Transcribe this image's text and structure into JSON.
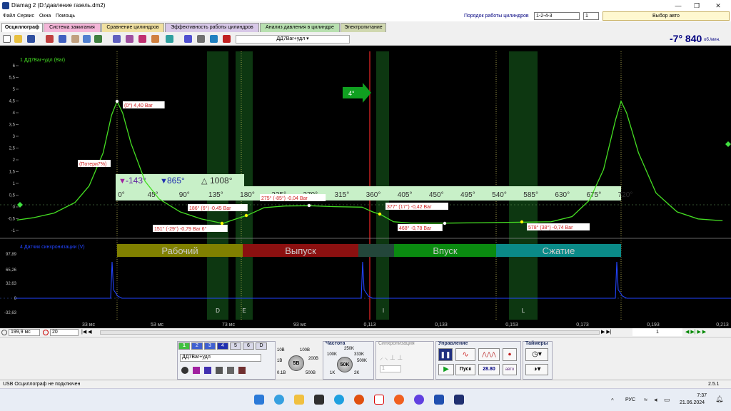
{
  "window": {
    "title": "Diamag 2 (D:\\давление газель.dm2)",
    "controls": [
      "—",
      "❐",
      "✕"
    ]
  },
  "menu": [
    "Файл",
    "Сервис",
    "Окна",
    "Помощь"
  ],
  "header": {
    "cyl_order_label": "Порядок работы цилиндров",
    "cyl_order_value": "1-2-4-3",
    "cyl_num_value": "1",
    "mode_value": "Выбор авто"
  },
  "tabs": [
    {
      "label": "Осциллограф",
      "color": "#ffffff"
    },
    {
      "label": "Система зажигания",
      "color": "#f4b6d8"
    },
    {
      "label": "Сравнение цилиндров",
      "color": "#f0e0a0"
    },
    {
      "label": "Эффективность работы цилиндров",
      "color": "#d8c8e8"
    },
    {
      "label": "Анализ давления в цилиндре",
      "color": "#b8e0b0"
    },
    {
      "label": "Электропитание",
      "color": "#d0d8b0"
    }
  ],
  "toolbar": {
    "channel_select": "ДД7Bar+удл",
    "angle_value": "-7° 840",
    "rpm_unit": "об./мин."
  },
  "chart_data": {
    "type": "line",
    "title": "",
    "pressure_channel": {
      "label": "1 ДД7Bar+удл (Bar)",
      "color": "#44dd22",
      "y_ticks": [
        "6",
        "5,5",
        "5",
        "4,5",
        "4",
        "3,5",
        "3",
        "2,5",
        "2",
        "1,5",
        "1",
        "0,5",
        "0",
        "-0,5",
        "-1"
      ],
      "ylim": [
        -1,
        6.5
      ]
    },
    "sync_channel": {
      "label": "4 Датчик синхронизации (V)",
      "color": "#2244ff",
      "y_ticks": [
        "97,89",
        "65,26",
        "32,63",
        "0",
        "-32,63"
      ]
    },
    "x_ticks_ms": [
      "33 мс",
      "53 мс",
      "73 мс",
      "93 мс",
      "0,113",
      "0,133",
      "0,153",
      "0,173",
      "0,193",
      "0,213"
    ],
    "deg_ticks": [
      "0°",
      "45°",
      "90°",
      "135°",
      "180°",
      "225°",
      "270°",
      "315°",
      "360°",
      "405°",
      "450°",
      "495°",
      "540°",
      "585°",
      "630°",
      "675°",
      "720°"
    ],
    "cursor_readouts": {
      "left": "-143°",
      "right": "865°",
      "delta": "1008°"
    },
    "annotations": [
      "(0°) 4,40 Bar",
      "(Потери7%)",
      "275° (-85°) -0,04 Bar",
      "186° (6°) -0,45 Bar",
      "377° (17°) -0,42 Bar",
      "151° (-29°) -0,79 Bar 6°",
      "468° -0,78 Bar",
      "578° (38°) -0,74 Bar"
    ],
    "ignition_marker": "4°",
    "phases": [
      {
        "label": "Рабочий",
        "color": "#808000"
      },
      {
        "label": "Выпуск",
        "color": "#8b1010"
      },
      {
        "label": "Впуск",
        "color": "#0a8a10"
      },
      {
        "label": "Сжатие",
        "color": "#0a8a88"
      }
    ],
    "valve_labels": [
      "D",
      "E",
      "I",
      "L"
    ],
    "series": [
      {
        "name": "1 ДД7Bar+удл (Bar)",
        "points": [
          [
            -143,
            -0.65
          ],
          [
            -120,
            -0.55
          ],
          [
            -90,
            -0.35
          ],
          [
            -60,
            0.1
          ],
          [
            -40,
            0.8
          ],
          [
            -20,
            2.2
          ],
          [
            -8,
            3.8
          ],
          [
            0,
            4.4
          ],
          [
            8,
            3.9
          ],
          [
            20,
            2.6
          ],
          [
            40,
            1.0
          ],
          [
            60,
            0.25
          ],
          [
            90,
            -0.3
          ],
          [
            120,
            -0.6
          ],
          [
            151,
            -0.79
          ],
          [
            170,
            -0.6
          ],
          [
            186,
            -0.45
          ],
          [
            210,
            -0.12
          ],
          [
            240,
            -0.05
          ],
          [
            275,
            -0.04
          ],
          [
            310,
            -0.08
          ],
          [
            350,
            -0.1
          ],
          [
            365,
            -0.3
          ],
          [
            377,
            -0.42
          ],
          [
            395,
            -0.72
          ],
          [
            420,
            -0.78
          ],
          [
            468,
            -0.78
          ],
          [
            520,
            -0.76
          ],
          [
            578,
            -0.74
          ],
          [
            620,
            -0.72
          ],
          [
            650,
            -0.5
          ],
          [
            675,
            0.2
          ],
          [
            695,
            1.5
          ],
          [
            712,
            3.6
          ],
          [
            720,
            4.4
          ],
          [
            728,
            3.9
          ],
          [
            745,
            2.2
          ],
          [
            770,
            0.5
          ],
          [
            800,
            -0.3
          ],
          [
            830,
            -0.6
          ],
          [
            865,
            -0.68
          ]
        ]
      }
    ]
  },
  "bottom_controls": {
    "time_scale": "199,9 мс",
    "zoom_value": "20",
    "page_value": "1",
    "channel_tabs": [
      "1",
      "2",
      "3",
      "4",
      "5",
      "6",
      "D"
    ],
    "sensor_field": "ДД7Bar+удл",
    "range_knob": {
      "value": "5В",
      "labels": [
        "10В",
        "100В",
        "200В",
        "1В",
        "0.1В",
        "500В"
      ]
    },
    "freq_title": "Частота",
    "freq_knob": {
      "value": "50K",
      "labels": [
        "100K",
        "250K",
        "333K",
        "500K",
        "1K",
        "2K"
      ]
    },
    "sync_title": "Синхронизация",
    "sync_channel": "1",
    "control_title": "Управление",
    "start_label": "Пуск",
    "freq_readout": "28.80",
    "auto_label": "авто",
    "timers_title": "Таймеры",
    "freq_label_right": "Частота"
  },
  "status": {
    "left": "USB Осциллограф не подключен",
    "version": "2.5.1"
  },
  "taskbar": {
    "lang": "РУС",
    "time": "7:37",
    "date": "21.06.2024"
  }
}
